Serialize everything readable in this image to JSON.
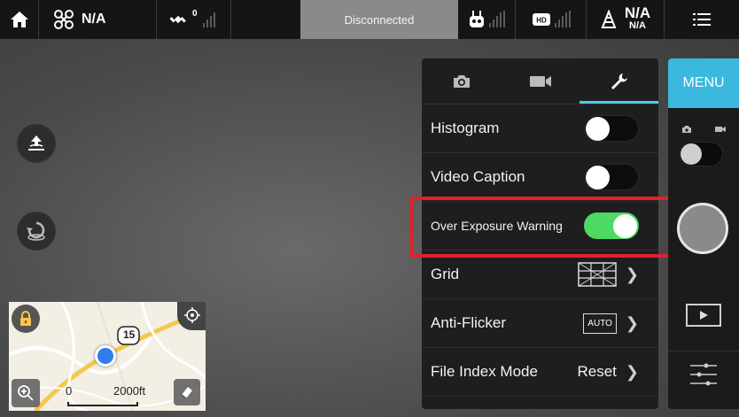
{
  "topbar": {
    "drone_status": "N/A",
    "gps_count": "0",
    "connection_status": "Disconnected",
    "battery_value": "N/A",
    "battery_sub": "N/A",
    "hd_label": "HD"
  },
  "map": {
    "route_shield": "15",
    "scale_start": "0",
    "scale_end": "2000ft"
  },
  "panel": {
    "tabs": [
      {
        "icon": "camera-icon",
        "active": false
      },
      {
        "icon": "video-camera-icon",
        "active": false
      },
      {
        "icon": "wrench-icon",
        "active": true
      }
    ],
    "rows": {
      "histogram": {
        "label": "Histogram",
        "on": false
      },
      "video_caption": {
        "label": "Video Caption",
        "on": false
      },
      "over_exposure": {
        "label": "Over Exposure Warning",
        "on": true
      },
      "grid": {
        "label": "Grid"
      },
      "anti_flicker": {
        "label": "Anti-Flicker",
        "badge": "AUTO"
      },
      "file_index": {
        "label": "File Index Mode",
        "value": "Reset"
      }
    }
  },
  "rail": {
    "menu_label": "MENU"
  },
  "colors": {
    "accent": "#3ab8de",
    "toggle_on": "#4cd964",
    "highlight": "#e3202b"
  }
}
